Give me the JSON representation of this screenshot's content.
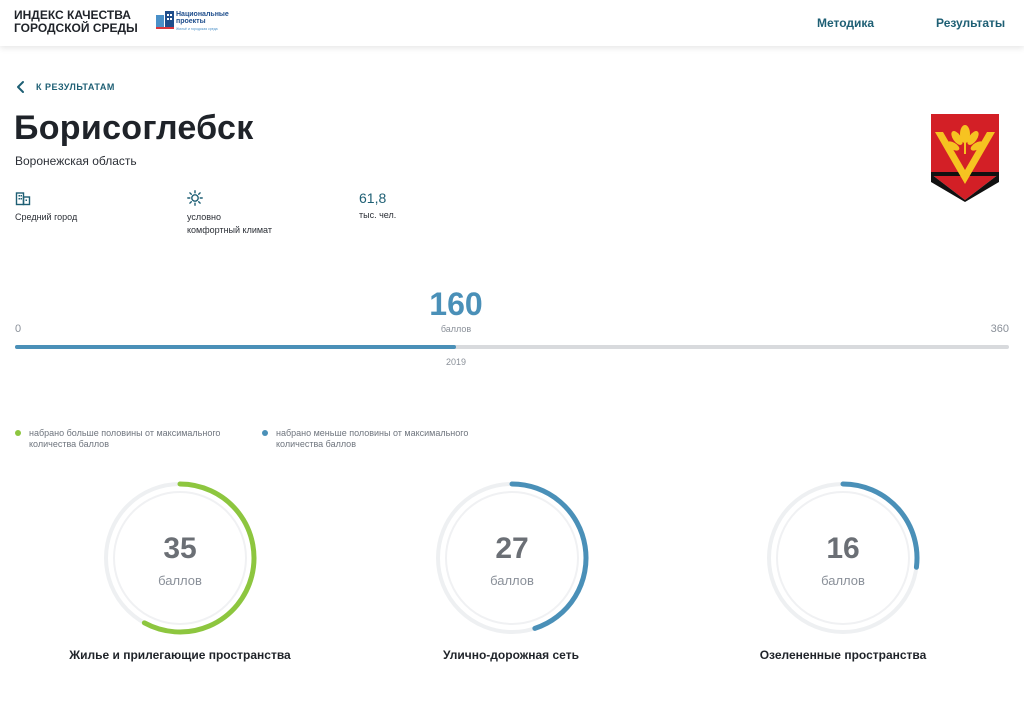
{
  "header": {
    "brand": "ИНДЕКС КАЧЕСТВА\nГОРОДСКОЙ СРЕДЫ",
    "np_logo": {
      "title": "Национальные\nпроекты",
      "subtitle": "Жильё и городская среда",
      "icon": "national-projects-logo"
    },
    "nav": {
      "methodology": "Методика",
      "results": "Результаты"
    }
  },
  "back": {
    "label": "К РЕЗУЛЬТАТАМ",
    "icon": "chevron-left-icon"
  },
  "city": {
    "name": "Борисоглебск",
    "region": "Воронежская область",
    "coat_of_arms": "coat-of-arms-icon"
  },
  "facts": [
    {
      "icon": "building-icon",
      "text": "Средний город"
    },
    {
      "icon": "sun-icon",
      "text": "условно\nкомфортный климат"
    },
    {
      "value": "61,8",
      "text": "тыс. чел."
    }
  ],
  "score": {
    "total": "160",
    "unit": "баллов",
    "min": "0",
    "max": "360",
    "year": "2019",
    "fraction": 0.444
  },
  "legend": [
    {
      "text": "набрано больше половины от максимального количества баллов",
      "color": "#8dc63f"
    },
    {
      "text": "набрано меньше половины от максимального количества баллов",
      "color": "#4a90b8"
    }
  ],
  "gauges": [
    {
      "value": "35",
      "unit": "баллов",
      "label": "Жилье и прилегающие пространства",
      "fraction": 0.58,
      "color": "#8dc63f"
    },
    {
      "value": "27",
      "unit": "баллов",
      "label": "Улично-дорожная сеть",
      "fraction": 0.45,
      "color": "#4a90b8"
    },
    {
      "value": "16",
      "unit": "баллов",
      "label": "Озелененные пространства",
      "fraction": 0.27,
      "color": "#4a90b8"
    }
  ],
  "colors": {
    "accent": "#4a90b8",
    "green": "#8dc63f",
    "link": "#1e5f74",
    "track": "#d8dadd"
  }
}
